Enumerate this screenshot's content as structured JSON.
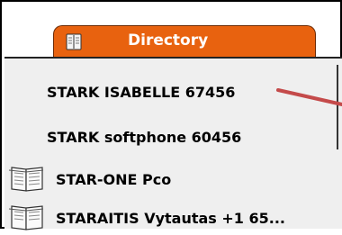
{
  "tab": {
    "label": "Directory",
    "icon": "book-icon"
  },
  "entries": [
    {
      "label": "STARK ISABELLE 67456",
      "icon": null
    },
    {
      "label": "STARK softphone 60456",
      "icon": null
    },
    {
      "label": "STAR-ONE Pco",
      "icon": "book-icon"
    },
    {
      "label": "STARAITIS Vytautas +1 65...",
      "icon": "book-icon"
    }
  ],
  "colors": {
    "tab": "#e8620f",
    "panel": "#efefef",
    "pointer": "#c44a4a"
  }
}
